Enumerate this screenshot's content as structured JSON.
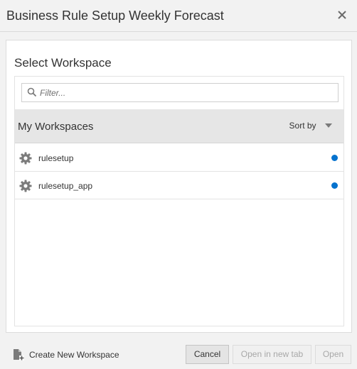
{
  "dialog": {
    "title": "Business Rule Setup Weekly Forecast",
    "close_icon": "close-icon"
  },
  "panel": {
    "heading": "Select Workspace",
    "filter": {
      "placeholder": "Filter...",
      "value": ""
    },
    "list": {
      "title": "My Workspaces",
      "sort_label": "Sort by",
      "items": [
        {
          "label": "rulesetup",
          "icon": "gear-icon",
          "status_color": "#0572ce"
        },
        {
          "label": "rulesetup_app",
          "icon": "gear-icon",
          "status_color": "#0572ce"
        }
      ]
    }
  },
  "footer": {
    "create_label": "Create New Workspace",
    "cancel_label": "Cancel",
    "open_new_tab_label": "Open in new tab",
    "open_label": "Open"
  }
}
